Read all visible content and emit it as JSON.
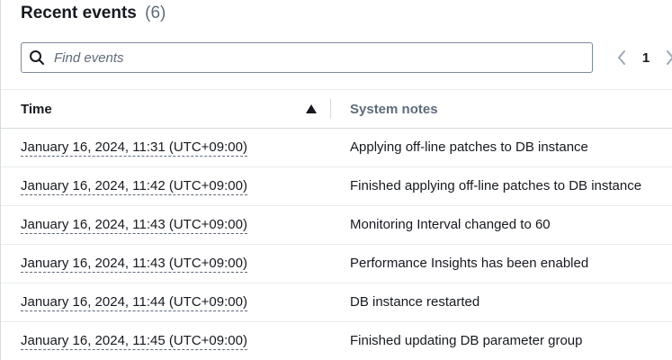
{
  "header": {
    "title": "Recent events",
    "count": "(6)"
  },
  "search": {
    "placeholder": "Find events",
    "value": "",
    "icon": "search-icon"
  },
  "pagination": {
    "current_page": "1",
    "prev_icon": "chevron-left-icon",
    "next_icon": "chevron-right-icon"
  },
  "table": {
    "columns": {
      "time": "Time",
      "notes": "System notes"
    },
    "sort": {
      "column": "time",
      "direction": "ascending",
      "icon": "sort-ascending-icon"
    },
    "rows": [
      {
        "time": "January 16, 2024, 11:31 (UTC+09:00)",
        "note": "Applying off-line patches to DB instance"
      },
      {
        "time": "January 16, 2024, 11:42 (UTC+09:00)",
        "note": "Finished applying off-line patches to DB instance"
      },
      {
        "time": "January 16, 2024, 11:43 (UTC+09:00)",
        "note": "Monitoring Interval changed to 60"
      },
      {
        "time": "January 16, 2024, 11:43 (UTC+09:00)",
        "note": "Performance Insights has been enabled"
      },
      {
        "time": "January 16, 2024, 11:44 (UTC+09:00)",
        "note": "DB instance restarted"
      },
      {
        "time": "January 16, 2024, 11:45 (UTC+09:00)",
        "note": "Finished updating DB parameter group"
      }
    ]
  },
  "colors": {
    "text": "#16191f",
    "muted": "#5f6b7a",
    "border": "#d5dbdb"
  }
}
